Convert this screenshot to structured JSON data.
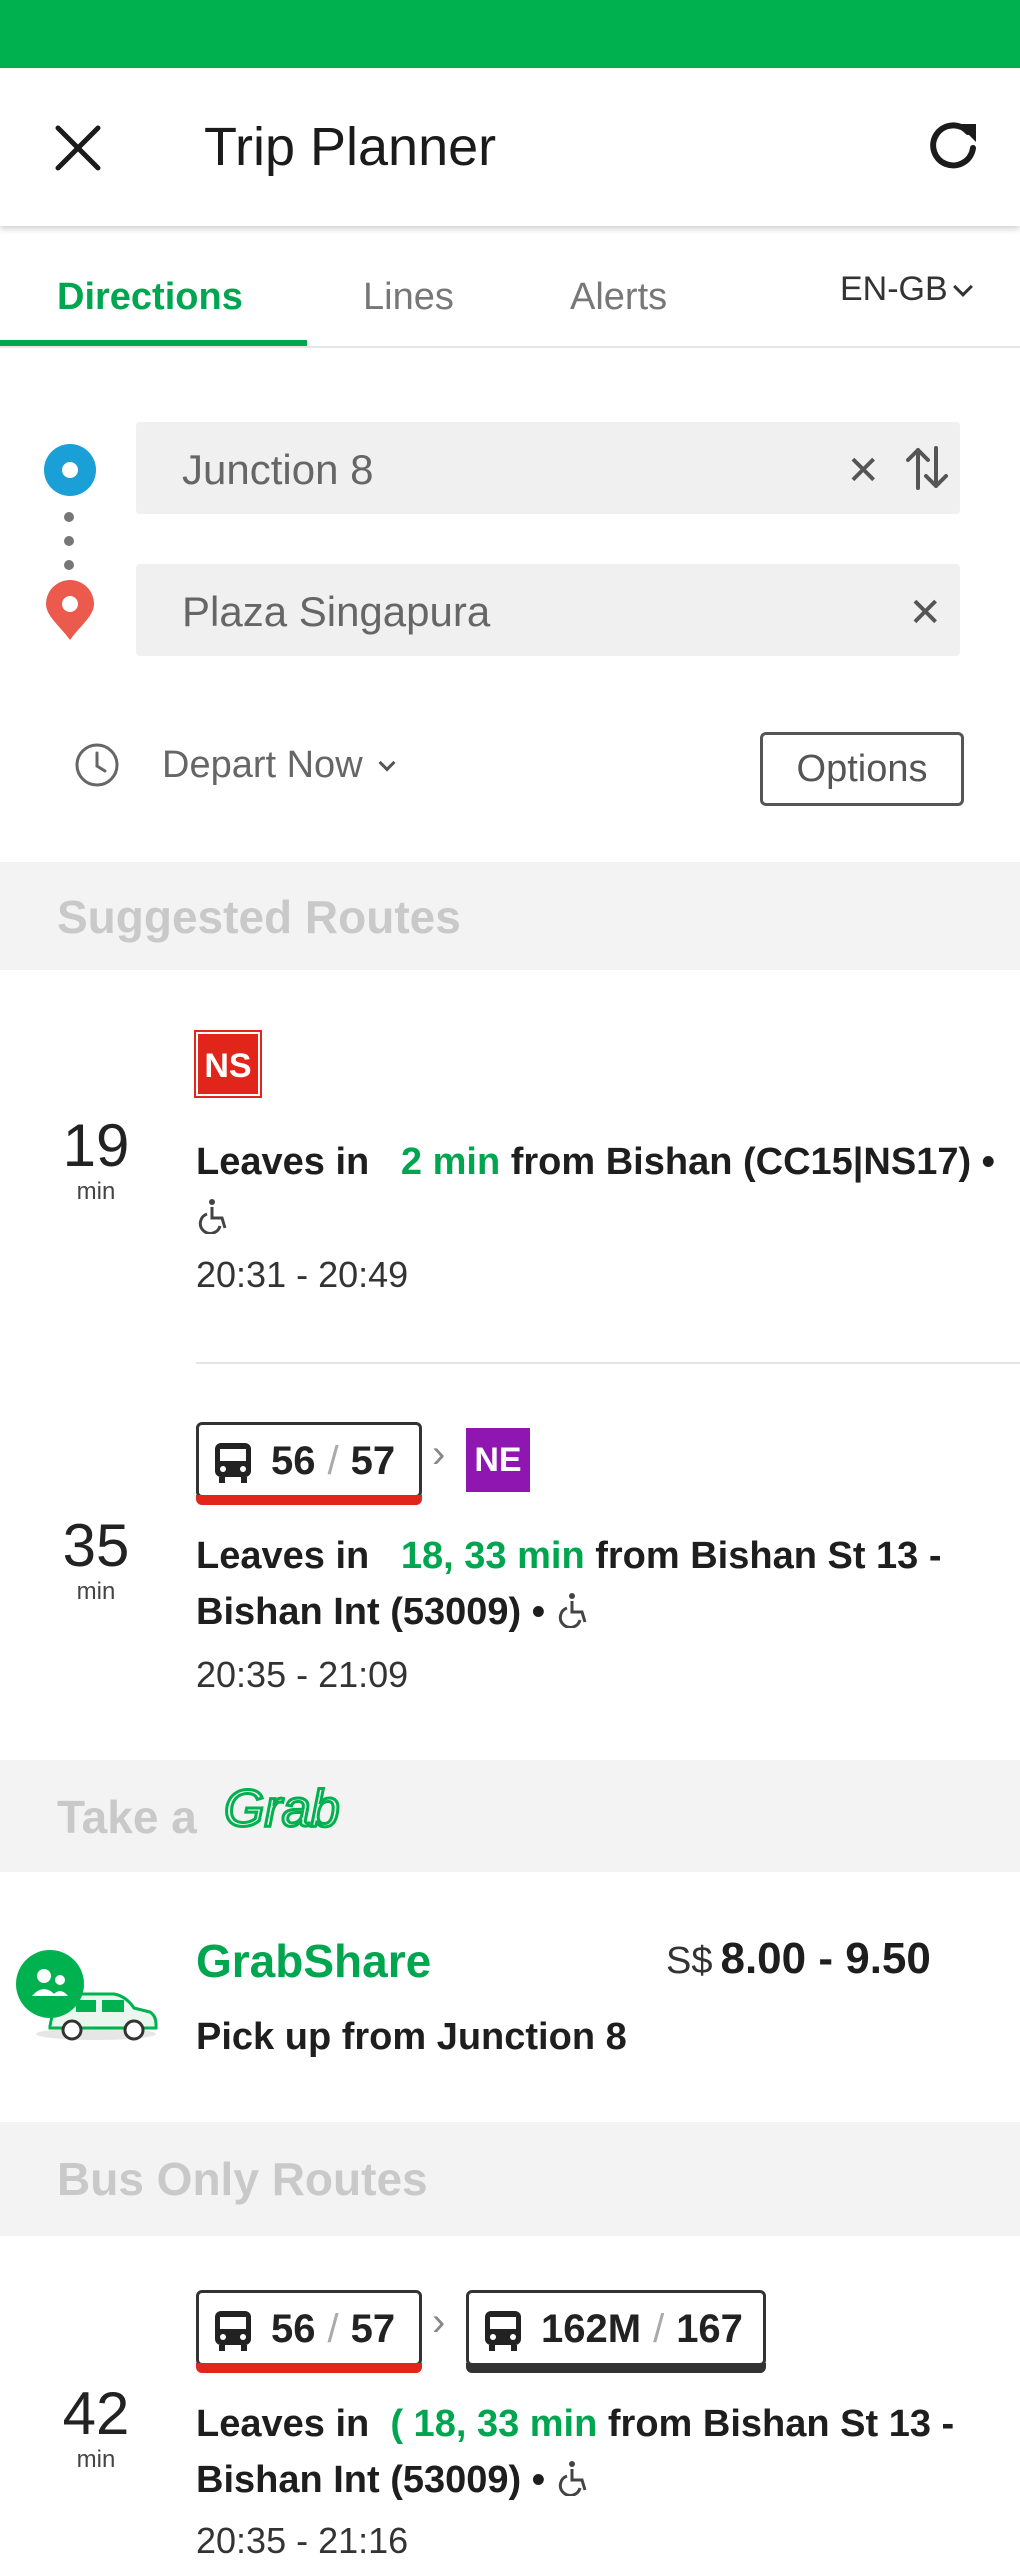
{
  "header": {
    "title": "Trip Planner",
    "close_icon": "close-icon",
    "refresh_icon": "refresh-icon"
  },
  "tabs": [
    {
      "label": "Directions",
      "active": true
    },
    {
      "label": "Lines",
      "active": false
    },
    {
      "label": "Alerts",
      "active": false
    }
  ],
  "language": "EN-GB",
  "planner": {
    "origin": "Junction 8",
    "destination": "Plaza Singapura",
    "depart_label": "Depart Now",
    "options_label": "Options"
  },
  "colors": {
    "brand_green": "#00b14f",
    "ns_line": "#e1251b",
    "ne_line": "#9016b2",
    "origin_blue": "#1aa0d6",
    "dest_red": "#ec5a4d"
  },
  "sections": {
    "suggested": "Suggested Routes",
    "take_a": "Take a",
    "grab_logo_text": "Grab",
    "bus_only": "Bus Only Routes"
  },
  "routes": [
    {
      "duration": "19",
      "unit": "min",
      "line_badge": "NS",
      "leaves_prefix": "Leaves in",
      "leaves_time": "2 min",
      "leaves_rest": "from Bishan (CC15|NS17) •",
      "times": "20:31 - 20:49"
    },
    {
      "duration": "35",
      "unit": "min",
      "bus_a": "56",
      "bus_b": "57",
      "line_badge": "NE",
      "leaves_prefix": "Leaves in",
      "leaves_time": "18, 33 min",
      "leaves_rest": "from Bishan St 13 - Bishan Int (53009) •",
      "times": "20:35 - 21:09"
    }
  ],
  "grabshare": {
    "name": "GrabShare",
    "currency": "S$",
    "price": "8.00 - 9.50",
    "pickup": "Pick up from Junction 8"
  },
  "bus_routes": [
    {
      "duration": "42",
      "unit": "min",
      "bus_a": "56",
      "bus_b": "57",
      "bus_c": "162M",
      "bus_d": "167",
      "leaves_prefix": "Leaves in",
      "leaves_time": "( 18, 33 min",
      "leaves_rest": "from Bishan St 13 - Bishan Int (53009) •",
      "times": "20:35 - 21:16"
    }
  ]
}
